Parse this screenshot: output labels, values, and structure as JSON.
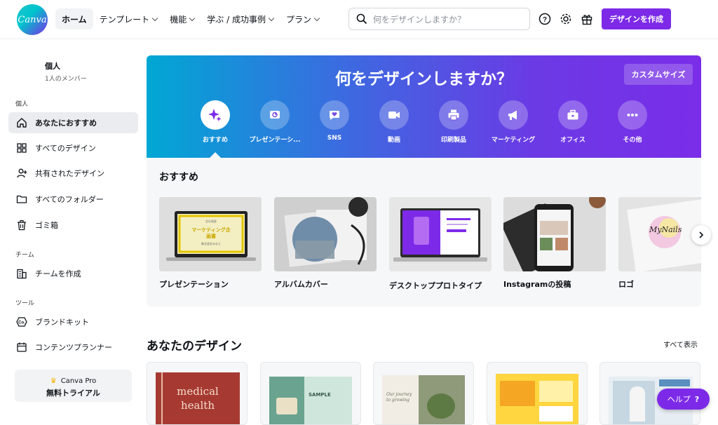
{
  "app": {
    "logo_text": "Canva"
  },
  "nav": {
    "items": [
      {
        "label": "ホーム"
      },
      {
        "label": "テンプレート"
      },
      {
        "label": "機能"
      },
      {
        "label": "学ぶ / 成功事例"
      },
      {
        "label": "プラン"
      }
    ]
  },
  "search": {
    "placeholder": "何をデザインしますか？"
  },
  "header": {
    "create_label": "デザインを作成"
  },
  "sidebar": {
    "team_name": "個人",
    "team_members": "1人のメンバー",
    "section_personal": "個人",
    "items": [
      {
        "label": "あなたにおすすめ"
      },
      {
        "label": "すべてのデザイン"
      },
      {
        "label": "共有されたデザイン"
      },
      {
        "label": "すべてのフォルダー"
      },
      {
        "label": "ゴミ箱"
      }
    ],
    "section_team": "チーム",
    "team_items": [
      {
        "label": "チームを作成"
      }
    ],
    "section_tools": "ツール",
    "tool_items": [
      {
        "label": "ブランドキット"
      },
      {
        "label": "コンテンツプランナー"
      }
    ],
    "pro": {
      "line1": "Canva Pro",
      "line2": "無料トライアル"
    }
  },
  "hero": {
    "title": "何をデザインしますか？",
    "custom_size": "カスタムサイズ",
    "categories": [
      {
        "label": "おすすめ",
        "icon": "sparkle-icon"
      },
      {
        "label": "プレゼンテーシ...",
        "icon": "presentation-icon"
      },
      {
        "label": "SNS",
        "icon": "heart-chat-icon"
      },
      {
        "label": "動画",
        "icon": "video-camera-icon"
      },
      {
        "label": "印刷製品",
        "icon": "printer-icon"
      },
      {
        "label": "マーケティング",
        "icon": "megaphone-icon"
      },
      {
        "label": "オフィス",
        "icon": "briefcase-icon"
      },
      {
        "label": "その他",
        "icon": "more-dots-icon"
      }
    ]
  },
  "recommended": {
    "title": "おすすめ",
    "cards": [
      {
        "label": "プレゼンテーション"
      },
      {
        "label": "アルバムカバー"
      },
      {
        "label": "デスクトッププロトタイプ"
      },
      {
        "label": "Instagramの投稿"
      },
      {
        "label": "ロゴ"
      }
    ],
    "thumb_text": {
      "pres_small": "会社概要",
      "pres_title": "マーケティング企画書",
      "pres_sub": "株式会社みなと",
      "logo_text": "MyNails"
    }
  },
  "your_designs": {
    "title": "あなたのデザイン",
    "see_all": "すべて表示",
    "medical_line1": "medical",
    "medical_line2": "health",
    "sample_text": "SAMPLE",
    "gardening_text": "Our journey to growing"
  },
  "help": {
    "label": "ヘルプ",
    "q": "?"
  },
  "colors": {
    "accent": "#7d2ae8",
    "brand_teal": "#00c4cc"
  }
}
